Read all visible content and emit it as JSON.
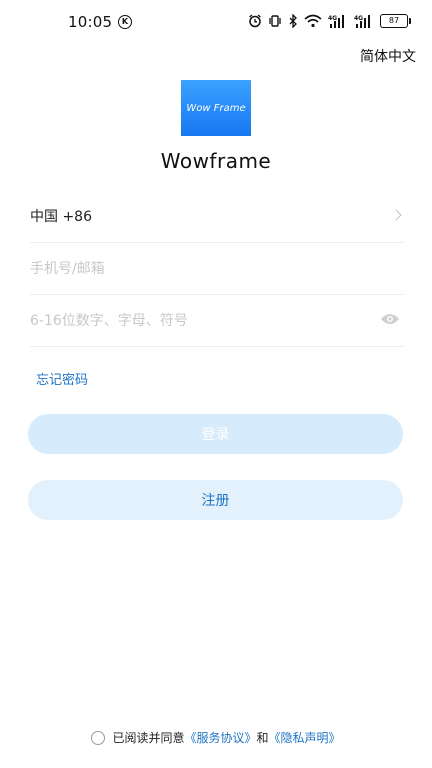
{
  "status_bar": {
    "time": "10:05",
    "k_badge": "K",
    "battery": "87",
    "icons": [
      "alarm-icon",
      "vibrate-icon",
      "bluetooth-icon",
      "wifi-icon",
      "signal-4g-icon",
      "signal-4g-icon-2",
      "battery-icon"
    ]
  },
  "header": {
    "language": "简体中文"
  },
  "logo": {
    "text": "Wow Frame",
    "gradient_top": "#3aa2ff",
    "gradient_bottom": "#1877f2"
  },
  "app_name": "Wowframe",
  "form": {
    "country_code": "中国 +86",
    "phone_placeholder": "手机号/邮箱",
    "password_placeholder": "6-16位数字、字母、符号",
    "forgot_password": "忘记密码"
  },
  "buttons": {
    "login": "登录",
    "register": "注册"
  },
  "agreement": {
    "prefix": "已阅读并同意",
    "service_link": "《服务协议》",
    "and": "和",
    "privacy_link": "《隐私声明》"
  },
  "colors": {
    "accent": "#1f74c4",
    "login_bg": "#d6ebfb",
    "register_bg": "#e3f1fc"
  }
}
